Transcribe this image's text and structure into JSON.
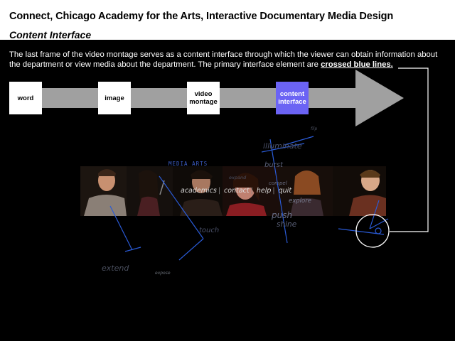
{
  "header": {
    "title": "Connect, Chicago Academy for the Arts, Interactive Documentary Media Design",
    "subtitle": "Content Interface"
  },
  "description": {
    "text": "The last frame of the video montage serves as a content interface through which the viewer can obtain information about the department or view media about the department. The primary interface element are ",
    "emphasis": "crossed blue lines."
  },
  "flow": {
    "steps": [
      {
        "label": "word"
      },
      {
        "label": "image"
      },
      {
        "label": "video montage"
      },
      {
        "label": "content interface"
      }
    ]
  },
  "interface": {
    "label": "MEDIA ARTS",
    "nav": [
      "academics",
      "contact",
      "help",
      "quit"
    ],
    "words": {
      "illuminate": "illuminate",
      "burst": "burst",
      "expand": "expand",
      "compel": "compel",
      "explore": "explore",
      "push": "push",
      "shine": "shine",
      "touch": "touch",
      "extend": "extend",
      "expose": "expose",
      "flip": "flip"
    }
  },
  "colors": {
    "accent": "#6b63f4",
    "line": "#2a5bd7",
    "arrow": "#a0a0a0"
  }
}
